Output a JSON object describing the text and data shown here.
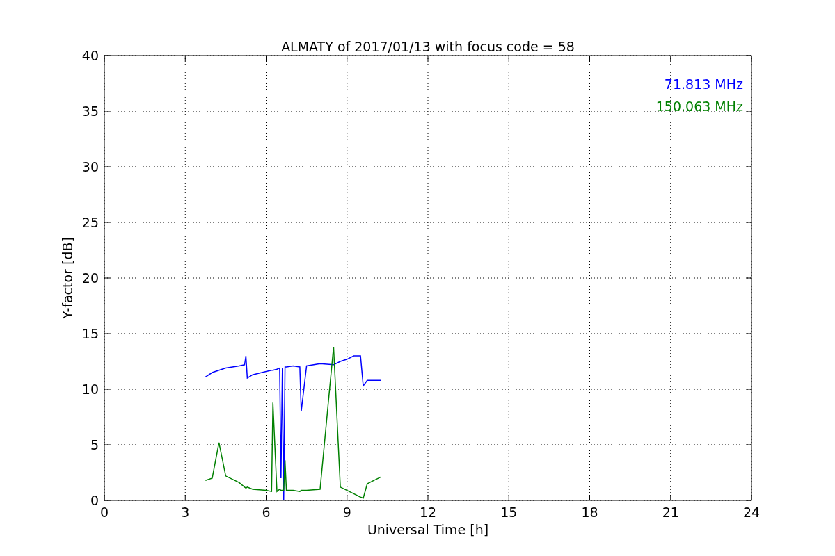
{
  "chart": {
    "chart_data": {
      "type": "line",
      "title": "ALMATY of 2017/01/13 with focus code = 58",
      "xlabel": "Universal Time [h]",
      "ylabel": "Y-factor [dB]",
      "grid": true,
      "xlim": [
        0,
        24
      ],
      "ylim": [
        0,
        40
      ],
      "xticks": [
        0,
        3,
        6,
        9,
        12,
        15,
        18,
        21,
        24
      ],
      "yticks": [
        0,
        5,
        10,
        15,
        20,
        25,
        30,
        35,
        40
      ],
      "x": [
        3.75,
        4,
        4.25,
        4.5,
        5,
        5.2,
        5.25,
        5.3,
        5.5,
        6,
        6.2,
        6.25,
        6.4,
        6.5,
        6.55,
        6.6,
        6.65,
        6.7,
        6.75,
        7,
        7.25,
        7.3,
        7.5,
        8,
        8.5,
        8.75,
        9,
        9.25,
        9.5,
        9.6,
        9.75,
        10,
        10.25
      ],
      "series": [
        {
          "name": "71.813 MHz",
          "color": "#0000ff",
          "values": [
            11.1,
            11.5,
            11.7,
            11.9,
            12.1,
            12.2,
            13.0,
            11.0,
            11.3,
            11.6,
            11.7,
            11.7,
            11.8,
            11.9,
            2,
            11.9,
            0,
            12.0,
            12.0,
            12.1,
            12.0,
            8,
            12.1,
            12.3,
            12.2,
            12.5,
            12.7,
            13.0,
            13.0,
            10.3,
            10.8,
            10.8,
            10.8
          ]
        },
        {
          "name": "150.063 MHz",
          "color": "#008000",
          "values": [
            1.8,
            2.0,
            5.2,
            2.2,
            1.6,
            1.2,
            1.1,
            1.2,
            1.0,
            0.9,
            0.8,
            8.8,
            0.8,
            1.0,
            0.9,
            0.9,
            0.9,
            3.6,
            0.9,
            0.9,
            0.8,
            0.9,
            0.9,
            1.0,
            13.8,
            1.2,
            0.9,
            0.6,
            0.3,
            0.2,
            1.5,
            1.8,
            2.1
          ]
        }
      ]
    }
  }
}
